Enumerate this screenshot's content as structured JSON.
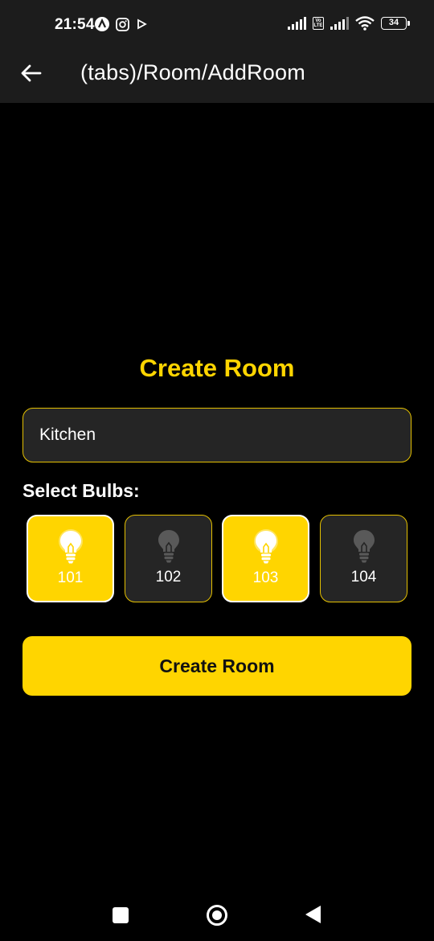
{
  "status_bar": {
    "time": "21:54",
    "battery": "34",
    "volte": "Vo LTE",
    "icons": [
      "app-a-icon",
      "instagram-icon",
      "play-icon",
      "signal-icon",
      "volte-icon",
      "signal-icon",
      "wifi-icon",
      "battery-icon"
    ]
  },
  "header": {
    "title": "(tabs)/Room/AddRoom",
    "back_icon": "arrow-left-icon"
  },
  "page_title": "Create Room",
  "room_name": {
    "value": "Kitchen"
  },
  "select_label": "Select Bulbs:",
  "bulbs": [
    {
      "label": "101",
      "selected": true
    },
    {
      "label": "102",
      "selected": false
    },
    {
      "label": "103",
      "selected": true
    },
    {
      "label": "104",
      "selected": false
    }
  ],
  "create_button": "Create Room",
  "colors": {
    "accent": "#ffd500",
    "background": "#000000",
    "surface": "#252525",
    "header": "#1c1c1c"
  },
  "nav": [
    "recents-icon",
    "home-icon",
    "back-icon"
  ]
}
